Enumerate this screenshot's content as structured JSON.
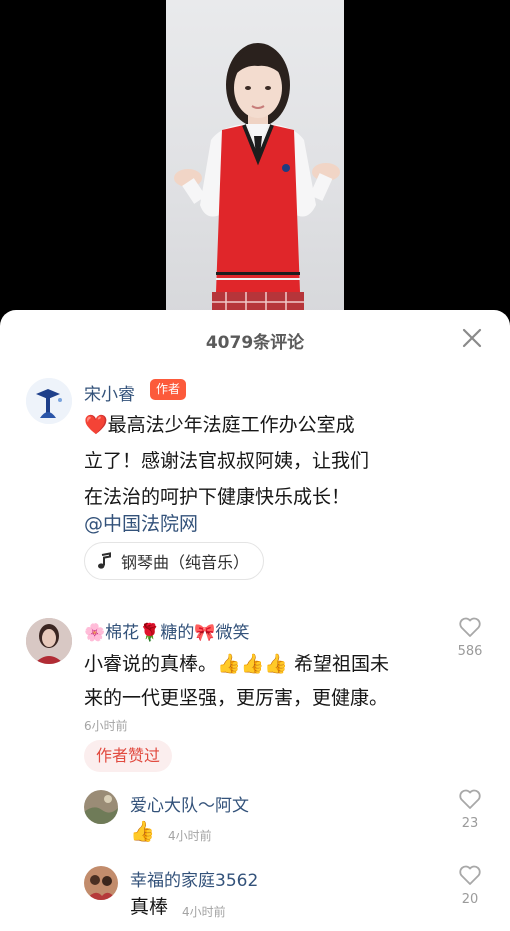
{
  "sheet": {
    "comment_count": "4079条评论"
  },
  "author_post": {
    "name": "宋小睿",
    "tag": "作者",
    "heart": "❤️",
    "caption_lines": [
      "最高法少年法庭工作办公室成",
      "立了！感谢法官叔叔阿姨，让我们",
      "在法治的呵护下健康快乐成长！"
    ],
    "mention": "@中国法院网",
    "music": "钢琴曲（纯音乐）"
  },
  "comments": [
    {
      "name": "🌸棉花🌹糖的🎀微笑",
      "text_line1": "小睿说的真棒。👍👍👍 希望祖国未",
      "text_line2": "来的一代更坚强，更厉害，更健康。",
      "time": "6小时前",
      "likes": "586",
      "badge": "作者赞过"
    },
    {
      "name": "爱心大队～阿文",
      "text": "👍",
      "time": "4小时前",
      "likes": "23"
    },
    {
      "name": "幸福的家庭3562",
      "text": "真棒",
      "time": "4小时前",
      "likes": "20"
    }
  ],
  "colors": {
    "accent": "#fc5a3b",
    "link": "#33527a",
    "badge_bg": "#fbeeee"
  },
  "icons": {
    "close": "close-icon",
    "music": "music-note-icon",
    "like": "heart-outline-icon"
  }
}
